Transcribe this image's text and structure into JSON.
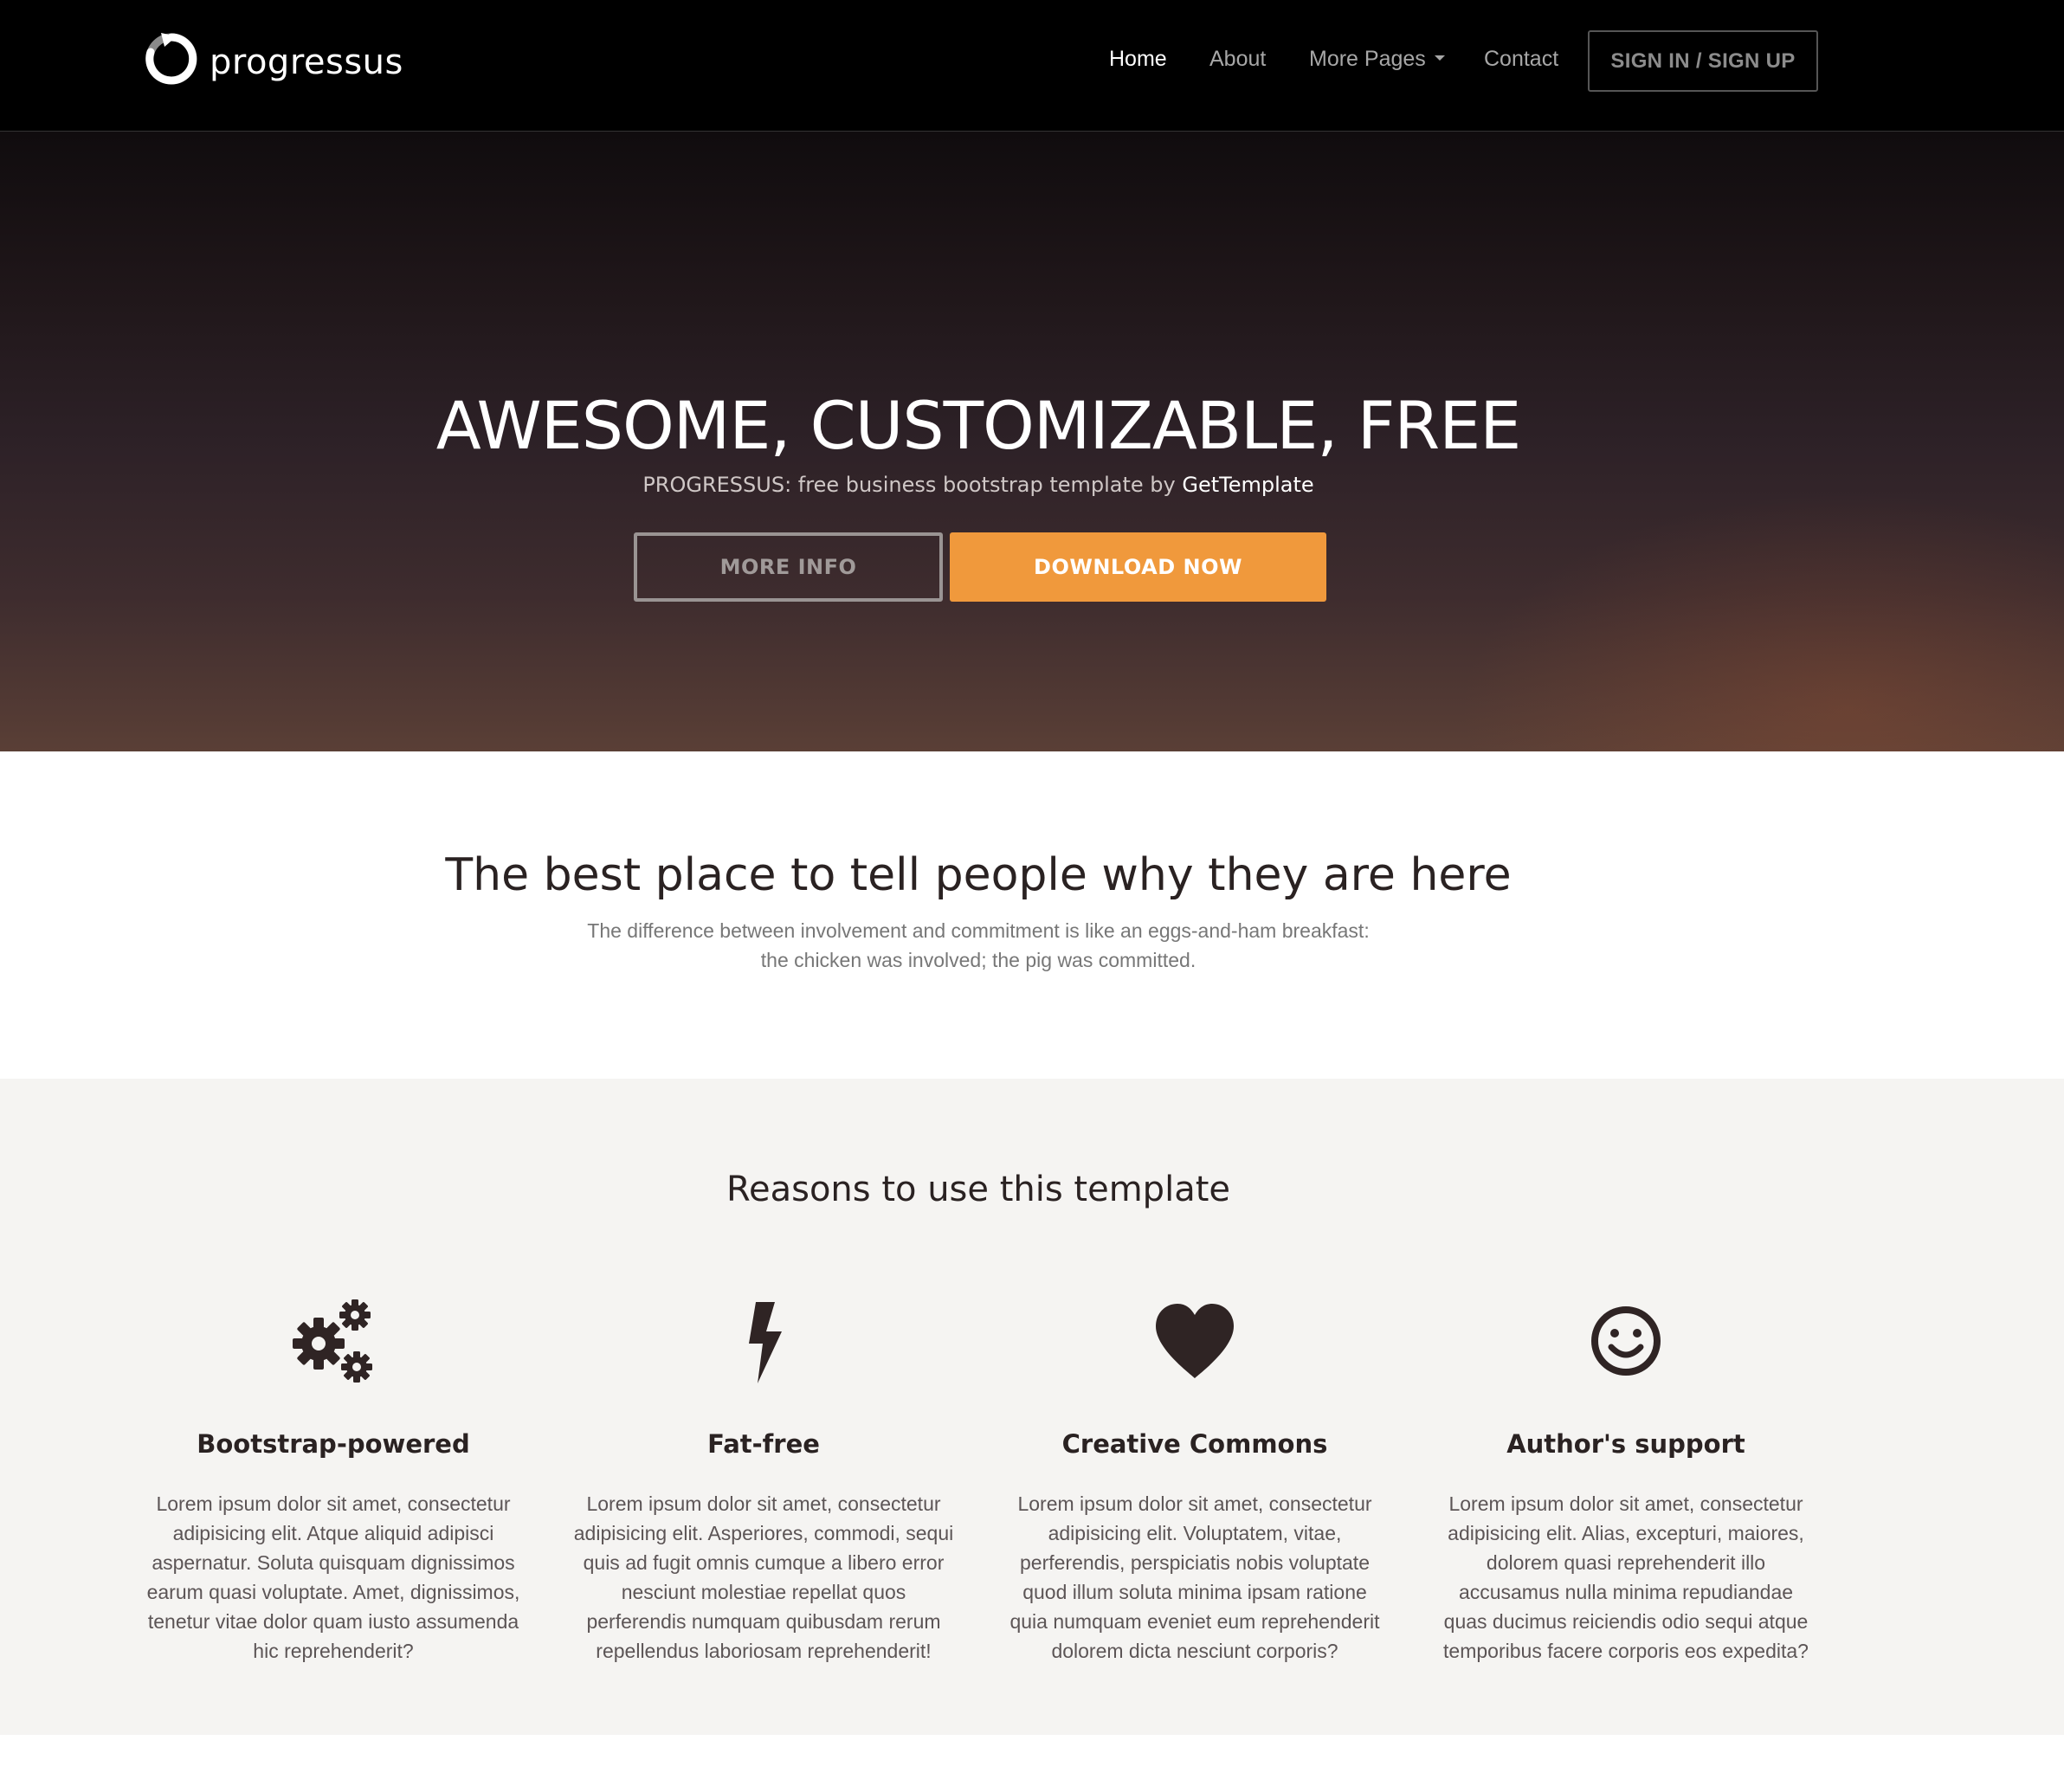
{
  "brand": {
    "name": "progressus",
    "logo_icon": "progress-ring-icon"
  },
  "nav": {
    "items": [
      {
        "label": "Home",
        "active": true
      },
      {
        "label": "About",
        "active": false
      },
      {
        "label": "More Pages",
        "active": false,
        "has_dropdown": true
      },
      {
        "label": "Contact",
        "active": false
      }
    ],
    "signin_label": "SIGN IN / SIGN UP"
  },
  "hero": {
    "title": "AWESOME, CUSTOMIZABLE, FREE",
    "subtitle_prefix": "PROGRESSUS: free business bootstrap template by ",
    "subtitle_link": "GetTemplate",
    "btn_more": "MORE INFO",
    "btn_download": "DOWNLOAD NOW"
  },
  "intro": {
    "title": "The best place to tell people why they are here",
    "line1": "The difference between involvement and commitment is like an eggs-and-ham breakfast:",
    "line2": "the chicken was involved; the pig was committed."
  },
  "reasons": {
    "title": "Reasons to use this template",
    "features": [
      {
        "icon": "gears-icon",
        "title": "Bootstrap-powered",
        "text": "Lorem ipsum dolor sit amet, consectetur adipisicing elit. Atque aliquid adipisci aspernatur. Soluta quisquam dignissimos earum quasi voluptate. Amet, dignissimos, tenetur vitae dolor quam iusto assumenda hic reprehenderit?"
      },
      {
        "icon": "lightning-icon",
        "title": "Fat-free",
        "text": "Lorem ipsum dolor sit amet, consectetur adipisicing elit. Asperiores, commodi, sequi quis ad fugit omnis cumque a libero error nesciunt molestiae repellat quos perferendis numquam quibusdam rerum repellendus laboriosam reprehenderit!"
      },
      {
        "icon": "heart-icon",
        "title": "Creative Commons",
        "text": "Lorem ipsum dolor sit amet, consectetur adipisicing elit. Voluptatem, vitae, perferendis, perspiciatis nobis voluptate quod illum soluta minima ipsam ratione quia numquam eveniet eum reprehenderit dolorem dicta nesciunt corporis?"
      },
      {
        "icon": "smiley-icon",
        "title": "Author's support",
        "text": "Lorem ipsum dolor sit amet, consectetur adipisicing elit. Alias, excepturi, maiores, dolorem quasi reprehenderit illo accusamus nulla minima repudiandae quas ducimus reiciendis odio sequi atque temporibus facere corporis eos expedita?"
      }
    ]
  },
  "colors": {
    "accent": "#f0993c",
    "navbar_bg": "#000000",
    "reasons_bg": "#f5f4f2",
    "heading": "#2a2222"
  }
}
